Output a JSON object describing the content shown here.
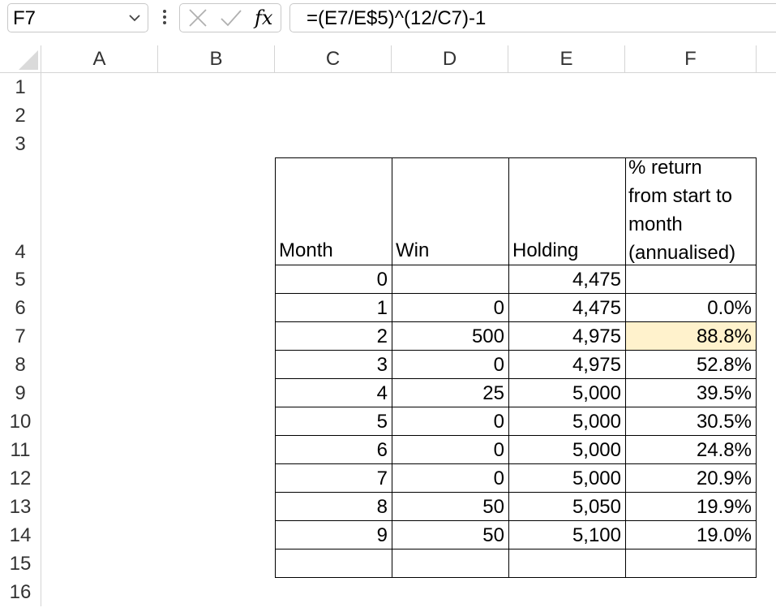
{
  "formula_bar": {
    "name_box": "F7",
    "formula": "=(E7/E$5)^(12/C7)-1",
    "fx_label": "fx"
  },
  "columns": [
    "A",
    "B",
    "C",
    "D",
    "E",
    "F"
  ],
  "rows": [
    "1",
    "2",
    "3",
    "4",
    "5",
    "6",
    "7",
    "8",
    "9",
    "10",
    "11",
    "12",
    "13",
    "14",
    "15",
    "16"
  ],
  "table": {
    "headers": {
      "month": "Month",
      "win": "Win",
      "holding": "Holding",
      "return_line1": "% return",
      "return_line2": "from start to",
      "return_line3": "month",
      "return_line4": "(annualised)"
    },
    "data": [
      {
        "month": "0",
        "win": "",
        "holding": "4,475",
        "ret": ""
      },
      {
        "month": "1",
        "win": "0",
        "holding": "4,475",
        "ret": "0.0%"
      },
      {
        "month": "2",
        "win": "500",
        "holding": "4,975",
        "ret": "88.8%"
      },
      {
        "month": "3",
        "win": "0",
        "holding": "4,975",
        "ret": "52.8%"
      },
      {
        "month": "4",
        "win": "25",
        "holding": "5,000",
        "ret": "39.5%"
      },
      {
        "month": "5",
        "win": "0",
        "holding": "5,000",
        "ret": "30.5%"
      },
      {
        "month": "6",
        "win": "0",
        "holding": "5,000",
        "ret": "24.8%"
      },
      {
        "month": "7",
        "win": "0",
        "holding": "5,000",
        "ret": "20.9%"
      },
      {
        "month": "8",
        "win": "50",
        "holding": "5,050",
        "ret": "19.9%"
      },
      {
        "month": "9",
        "win": "50",
        "holding": "5,100",
        "ret": "19.0%"
      },
      {
        "month": "",
        "win": "",
        "holding": "",
        "ret": ""
      }
    ]
  },
  "colors": {
    "selected_cell": "#fff2cc",
    "grid_line": "#d4d4d4"
  }
}
